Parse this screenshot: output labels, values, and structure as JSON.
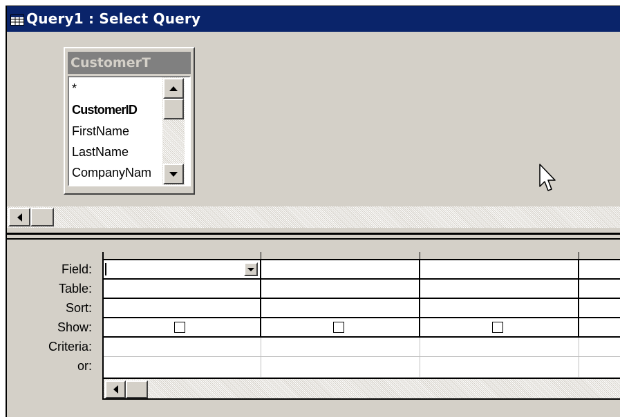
{
  "window": {
    "title": "Query1 : Select Query",
    "icon": "query-grid-icon"
  },
  "table": {
    "title": "CustomerT",
    "fields": [
      "*",
      "CustomerID",
      "FirstName",
      "LastName",
      "CompanyNam"
    ]
  },
  "design_grid": {
    "row_labels": [
      "Field:",
      "Table:",
      "Sort:",
      "Show:",
      "Criteria:",
      "or:"
    ],
    "columns": [
      {
        "field": "",
        "table": "",
        "sort": "",
        "show": false,
        "criteria": "",
        "or": ""
      },
      {
        "field": "",
        "table": "",
        "sort": "",
        "show": false,
        "criteria": "",
        "or": ""
      },
      {
        "field": "",
        "table": "",
        "sort": "",
        "show": false,
        "criteria": "",
        "or": ""
      }
    ]
  },
  "colors": {
    "titlebar": "#0a246a",
    "face": "#d4d0c8"
  }
}
